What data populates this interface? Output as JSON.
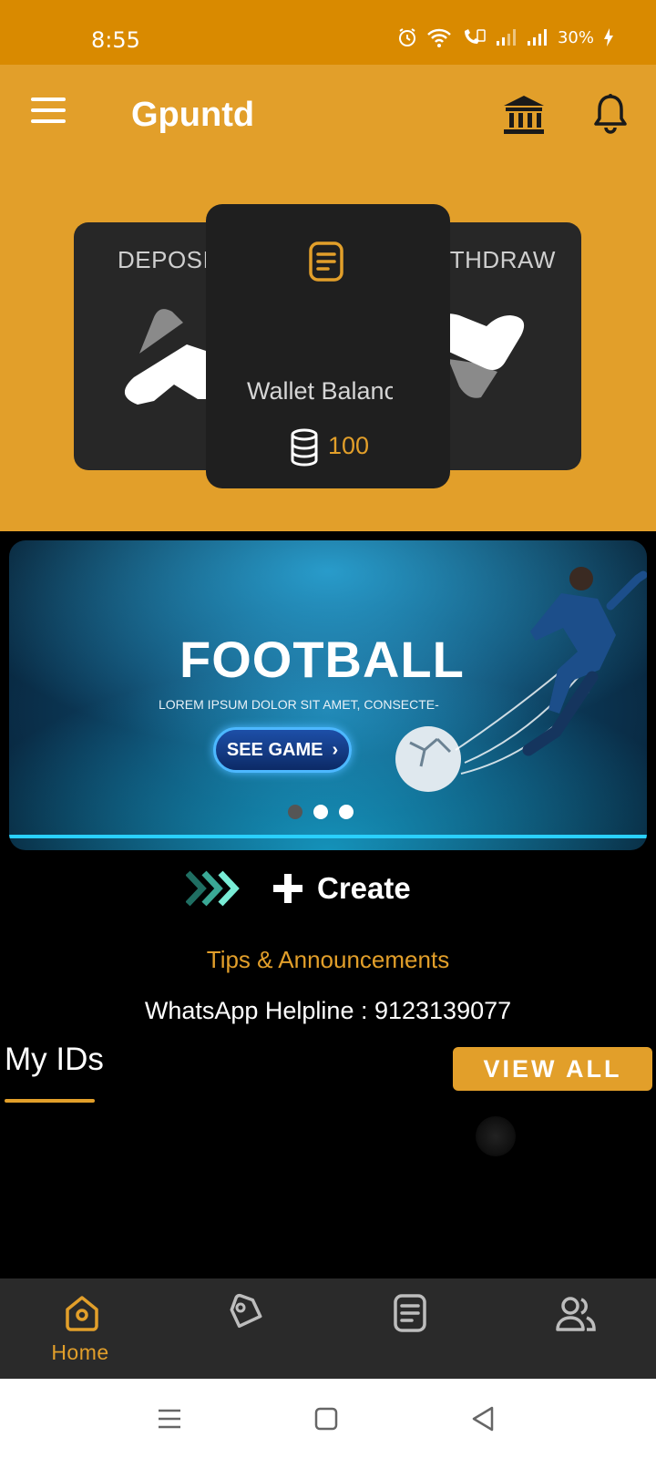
{
  "status_bar": {
    "time": "8:55",
    "battery": "30%"
  },
  "header": {
    "title": "Gpuntd",
    "menu_icon": "hamburger-icon",
    "bank_icon": "bank-icon",
    "bell_icon": "bell-icon"
  },
  "wallet": {
    "deposit_label": "DEPOSIT",
    "withdraw_label": "WITHDRAW",
    "balance_label": "Wallet Balance",
    "balance_value": "100",
    "wallet_icon": "wallet-note-icon",
    "coin_icon": "coin-stack-icon"
  },
  "banner": {
    "title": "FOOTBALL",
    "subtitle": "LOREM IPSUM DOLOR SIT AMET, CONSECTE-",
    "button": "SEE GAME",
    "slide_count": 3,
    "active_slide": 1
  },
  "create": {
    "label": "Create",
    "arrows_icon": "triple-chevron-icon",
    "plus_icon": "plus-icon"
  },
  "tips": "Tips & Announcements",
  "helpline": "WhatsApp Helpline : 9123139077",
  "ids": {
    "title": "My IDs",
    "view_all": "VIEW ALL"
  },
  "bottom_nav": [
    {
      "label": "Home",
      "icon": "home-icon",
      "active": true
    },
    {
      "label": "",
      "icon": "tag-icon",
      "active": false
    },
    {
      "label": "",
      "icon": "document-icon",
      "active": false
    },
    {
      "label": "",
      "icon": "users-icon",
      "active": false
    }
  ],
  "colors": {
    "status_bar": "#d98a00",
    "accent": "#e29f2a",
    "card": "#272727",
    "background": "#000000",
    "nav": "#2a2a2a"
  }
}
